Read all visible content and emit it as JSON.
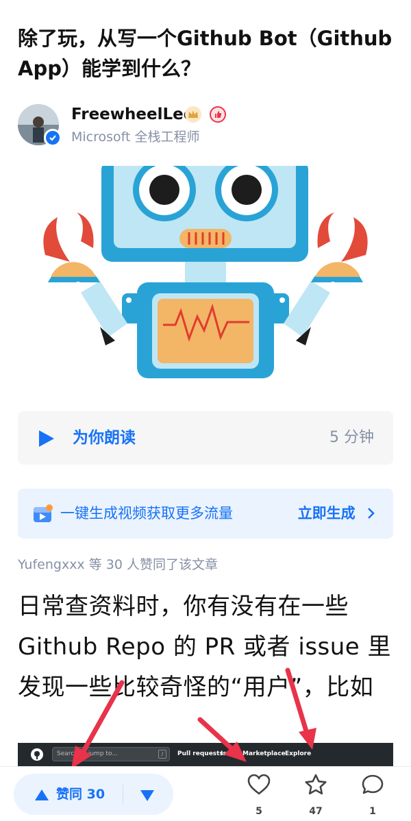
{
  "article": {
    "title": "除了玩，从写一个Github Bot（Github App）能学到什么？"
  },
  "author": {
    "name": "FreewheelLee",
    "description": "Microsoft 全栈工程师"
  },
  "read_aloud": {
    "label": "为你朗读",
    "duration": "5 分钟"
  },
  "video_promo": {
    "label": "一键生成视频获取更多流量",
    "button": "立即生成"
  },
  "likers": "Yufengxxx 等 30 人赞同了该文章",
  "body": {
    "paragraph": "日常查资料时，你有没有在一些Github Repo 的 PR 或者 issue 里发现一些比较奇怪的“用户”，比如"
  },
  "github_screenshot": {
    "search_placeholder": "Search or jump to...",
    "slash_key": "/",
    "nav": [
      "Pull requests",
      "Issues",
      "Marketplace",
      "Explore"
    ]
  },
  "bottom_bar": {
    "upvote_label": "赞同 30",
    "like_count": "5",
    "favorite_count": "47",
    "comment_count": "1"
  },
  "colors": {
    "accent": "#1772f6",
    "annotation_arrow": "#e8334a",
    "robot_blue": "#29a3d6",
    "robot_orange": "#f3b566"
  }
}
